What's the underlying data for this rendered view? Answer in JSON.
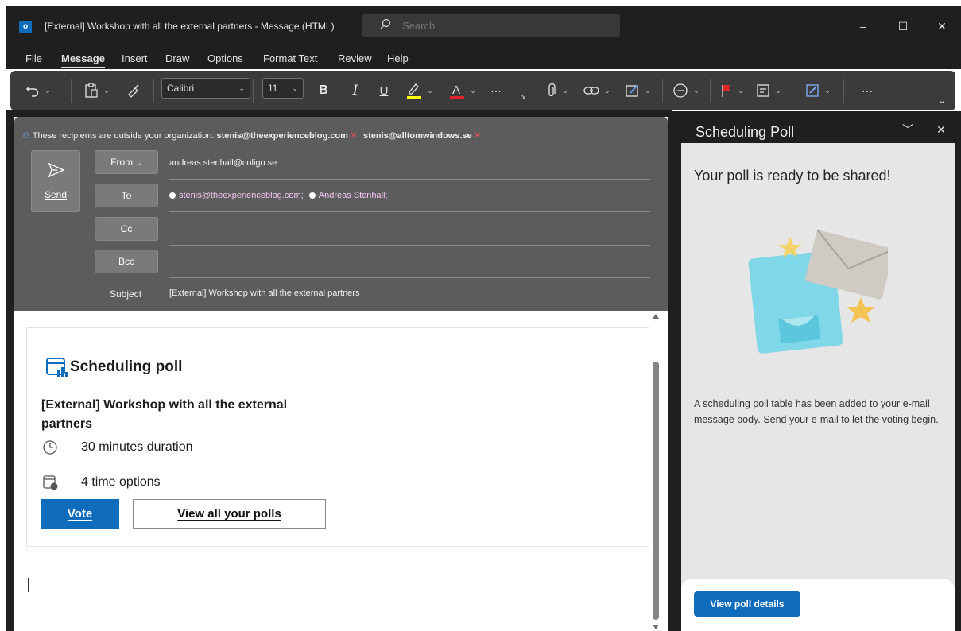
{
  "window": {
    "app_logo": "o",
    "title": "[External] Workshop with all the external partners  -  Message (HTML)",
    "search_placeholder": "Search",
    "controls": {
      "minimize": "–",
      "maximize": "☐",
      "close": "✕"
    }
  },
  "menu": {
    "items": [
      "File",
      "Message",
      "Insert",
      "Draw",
      "Options",
      "Format Text",
      "Review",
      "Help"
    ],
    "active": "Message"
  },
  "ribbon": {
    "font_name": "Calibri",
    "font_size": "11",
    "bold": "B",
    "italic": "I",
    "underline": "U",
    "more": "···",
    "overflow": "···",
    "highlight_color": "#ffff00",
    "font_color": "#e0242c"
  },
  "compose": {
    "external_notice_prefix": "These recipients are outside your organization:",
    "external_recipients": [
      "stenis@theexperienceblog.com",
      "stenis@alltomwindows.se"
    ],
    "send_label": "Send",
    "from_label": "From",
    "from_value": "andreas.stenhall@coligo.se",
    "to_label": "To",
    "to_recipients": [
      "stenis@theexperienceblog.com;",
      "Andreas Stenhall;"
    ],
    "cc_label": "Cc",
    "bcc_label": "Bcc",
    "subject_label": "Subject",
    "subject_value": "[External] Workshop with all the external partners"
  },
  "poll_card": {
    "title": "Scheduling poll",
    "subject": "[External] Workshop with all the external partners",
    "duration": "30 minutes duration",
    "options": "4 time options",
    "vote_label": "Vote",
    "view_polls_label": "View all your polls"
  },
  "side_pane": {
    "title": "Scheduling Poll",
    "heading": "Your poll is ready to be shared!",
    "description": "A scheduling poll table has been added to your e-mail message body. Send your e-mail to let the voting begin.",
    "button_label": "View poll details",
    "collapse_icon": "﹀",
    "close_icon": "✕"
  },
  "colors": {
    "accent": "#0f6cbd",
    "chrome_dark": "#1f1f1f",
    "header_gray": "#5c5c5c",
    "warning_red": "#e0524e"
  }
}
